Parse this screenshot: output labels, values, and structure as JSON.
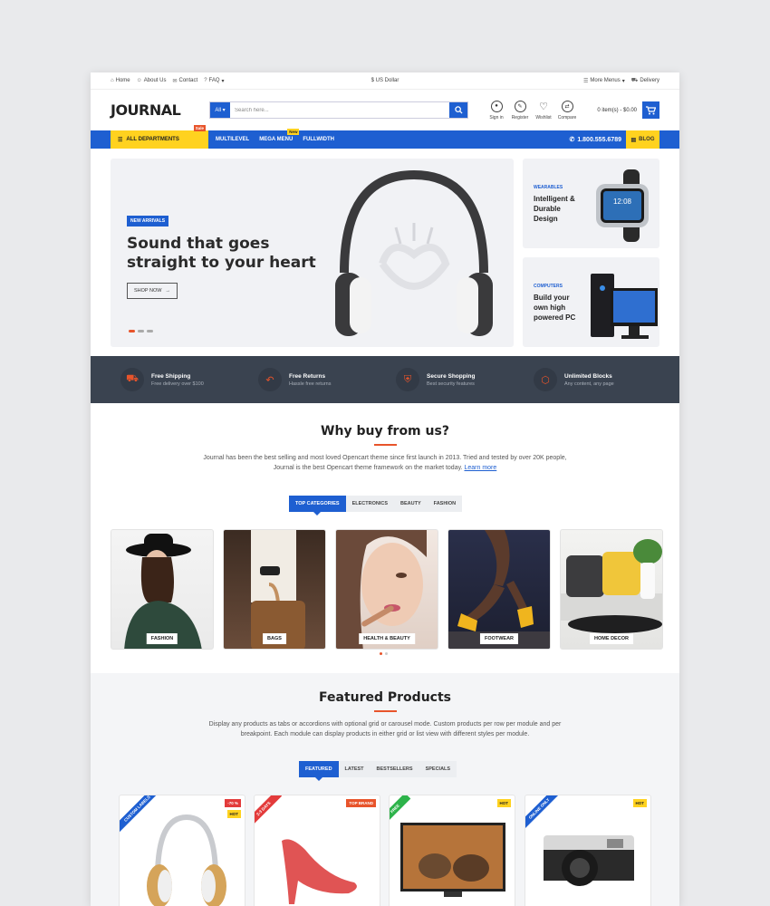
{
  "topbar": {
    "home": "Home",
    "about": "About Us",
    "contact": "Contact",
    "faq": "FAQ",
    "currency": "$ US Dollar",
    "more_menus": "More Menus",
    "delivery": "Delivery"
  },
  "header": {
    "logo": "JOURNAL",
    "search_category": "All",
    "search_placeholder": "Search here...",
    "icons": [
      {
        "label": "Sign in",
        "icon": "user-icon"
      },
      {
        "label": "Register",
        "icon": "compass-icon"
      },
      {
        "label": "Wishlist",
        "icon": "heart-icon"
      },
      {
        "label": "Compare",
        "icon": "compare-icon"
      }
    ],
    "cart_text": "0 item(s) - $0.00"
  },
  "nav": {
    "departments": "ALL DEPARTMENTS",
    "sale_badge": "Sale",
    "links": [
      "MULTILEVEL",
      "MEGA MENU",
      "FULLWIDTH"
    ],
    "new_badge": "New",
    "phone": "1.800.555.6789",
    "blog": "BLOG"
  },
  "hero": {
    "tag": "NEW ARRIVALS",
    "title": "Sound that goes straight to your heart",
    "button": "SHOP NOW"
  },
  "side_banners": [
    {
      "kicker": "WEARABLES",
      "head": "Intelligent & Durable Design"
    },
    {
      "kicker": "COMPUTERS",
      "head": "Build your own high powered PC"
    }
  ],
  "features": [
    {
      "title": "Free Shipping",
      "sub": "Free delivery over $100",
      "icon": "truck-icon"
    },
    {
      "title": "Free Returns",
      "sub": "Hassle free returns",
      "icon": "return-icon"
    },
    {
      "title": "Secure Shopping",
      "sub": "Best security features",
      "icon": "shield-icon"
    },
    {
      "title": "Unlimited Blocks",
      "sub": "Any content, any page",
      "icon": "box-icon"
    }
  ],
  "why": {
    "title": "Why buy from us?",
    "text1": "Journal has been the best selling and most loved Opencart theme since first launch in 2013. Tried and tested by over 20K people,",
    "text2": "Journal is the best Opencart theme framework on the market today.",
    "link": "Learn more"
  },
  "category_tabs": [
    "TOP CATEGORIES",
    "ELECTRONICS",
    "BEAUTY",
    "FASHION"
  ],
  "categories": [
    "FASHION",
    "BAGS",
    "HEALTH & BEAUTY",
    "FOOTWEAR",
    "HOME DECOR"
  ],
  "featured": {
    "title": "Featured Products",
    "text1": "Display any products as tabs or accordions with optional grid or carousel mode. Custom products per row per module and per",
    "text2": "breakpoint. Each module can display products in either grid or list view with different styles per module.",
    "tabs": [
      "FEATURED",
      "LATEST",
      "BESTSELLERS",
      "SPECIALS"
    ]
  },
  "products": [
    {
      "ribbon": "CUSTOM LABELS",
      "ribbon_color": "#1e5fd1",
      "badges": [
        "-70 %",
        "HOT"
      ]
    },
    {
      "ribbon": "2-3 DAYS",
      "ribbon_color": "#e33b3b",
      "badges": [
        "TOP BRAND"
      ]
    },
    {
      "ribbon": "FREE",
      "ribbon_color": "#2db34a",
      "badges": [
        "HOT"
      ]
    },
    {
      "ribbon": "ONLINE ONLY",
      "ribbon_color": "#1e5fd1",
      "badges": [
        "HOT"
      ]
    }
  ],
  "colors": {
    "primary": "#1e5fd1",
    "accent": "#ffd21f",
    "orange": "#e8542b",
    "dark": "#3a4350"
  }
}
